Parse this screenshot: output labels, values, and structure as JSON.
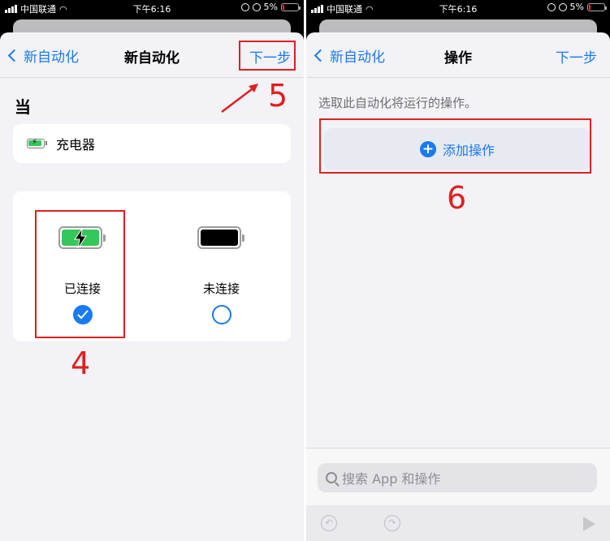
{
  "status_bar": {
    "carrier": "中国联通",
    "time": "下午6:16",
    "battery": "5%"
  },
  "left_screen": {
    "nav": {
      "back_label": "新自动化",
      "title": "新自动化",
      "next_label": "下一步"
    },
    "section_header": "当",
    "trigger": {
      "label": "充电器",
      "icon": "battery-charging-icon"
    },
    "options": [
      {
        "label": "已连接",
        "selected": true,
        "icon": "battery-charging-icon"
      },
      {
        "label": "未连接",
        "selected": false,
        "icon": "battery-empty-icon"
      }
    ],
    "annotations": {
      "step_4": "4",
      "step_5": "5"
    }
  },
  "right_screen": {
    "nav": {
      "back_label": "新自动化",
      "title": "操作",
      "next_label": "下一步"
    },
    "hint": "选取此自动化将运行的操作。",
    "add_action_label": "添加操作",
    "search_placeholder": "搜索 App 和操作",
    "annotations": {
      "step_6": "6"
    }
  },
  "colors": {
    "accent": "#1a7af0",
    "annotation_red": "#e01f1f",
    "battery_green": "#35c759"
  }
}
